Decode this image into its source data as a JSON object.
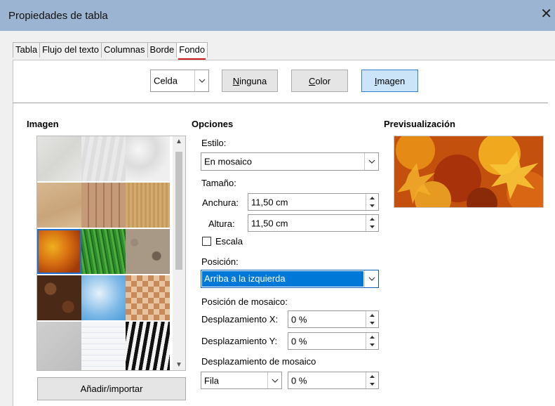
{
  "window": {
    "title": "Propiedades de tabla",
    "close_glyph": "✕"
  },
  "tabs": [
    {
      "label": "Tabla"
    },
    {
      "label": "Flujo del texto"
    },
    {
      "label": "Columnas"
    },
    {
      "label": "Borde"
    },
    {
      "label": "Fondo",
      "active": true
    }
  ],
  "target": {
    "selected": "Celda"
  },
  "fill_buttons": {
    "none": {
      "pre": "",
      "key": "N",
      "post": "inguna"
    },
    "color": {
      "pre": "",
      "key": "C",
      "post": "olor"
    },
    "image": {
      "pre": "",
      "key": "I",
      "post": "magen",
      "selected": true
    }
  },
  "image_section": {
    "heading": "Imagen",
    "add_button": "Añadir/importar",
    "tiles": [
      "painted",
      "paper",
      "stucco",
      "parchment",
      "fence",
      "cardboard",
      "maple-leaves",
      "grass",
      "pebbles",
      "coffee-beans",
      "sky",
      "color-squares",
      "concrete",
      "grid-paper",
      "zebra"
    ],
    "selected_tile": "maple-leaves"
  },
  "options": {
    "heading": "Opciones",
    "style_label": "Estilo:",
    "style_value": "En mosaico",
    "size_label": "Tamaño:",
    "width_label": "Anchura:",
    "width_value": "11,50 cm",
    "height_label": "Altura:",
    "height_value": "11,50 cm",
    "scale_label": "Escala",
    "scale_checked": false,
    "position_label": "Posición:",
    "position_value": "Arriba a la izquierda",
    "tile_position_label": "Posición de mosaico:",
    "offset_x_label": "Desplazamiento X:",
    "offset_x_value": "0 %",
    "offset_y_label": "Desplazamiento Y:",
    "offset_y_value": "0 %",
    "tile_offset_label": "Desplazamiento de mosaico",
    "tile_offset_mode": "Fila",
    "tile_offset_value": "0 %"
  },
  "preview": {
    "heading": "Previsualización"
  },
  "colors": {
    "selection": "#0078d7",
    "active_tab_underline": "#d01d1d",
    "titlebar": "#9bb4d1"
  }
}
